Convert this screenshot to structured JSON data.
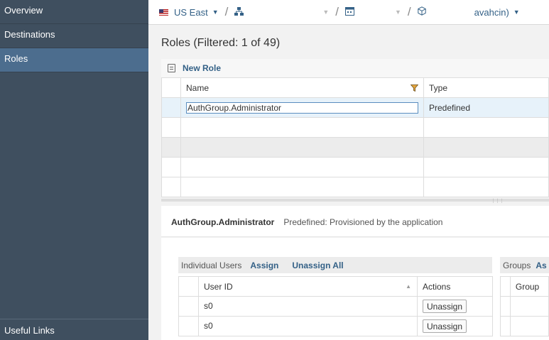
{
  "sidebar": {
    "items": [
      {
        "label": "Overview"
      },
      {
        "label": "Destinations"
      },
      {
        "label": "Roles",
        "active": true
      }
    ],
    "bottom_label": "Useful Links"
  },
  "topbar": {
    "region": "US East",
    "account_suffix": "avahcin)"
  },
  "title": "Roles (Filtered: 1 of 49)",
  "roles_table": {
    "new_role_label": "New Role",
    "columns": [
      "Name",
      "Type"
    ],
    "rows": [
      {
        "name": "AuthGroup.Administrator",
        "type": "Predefined"
      }
    ]
  },
  "detail": {
    "role_name": "AuthGroup.Administrator",
    "role_desc": "Predefined: Provisioned by the application"
  },
  "users": {
    "label": "Individual Users",
    "assign_label": "Assign",
    "unassign_all_label": "Unassign All",
    "columns": [
      "User ID",
      "Actions"
    ],
    "rows": [
      {
        "user_id": "s0",
        "action": "Unassign"
      },
      {
        "user_id": "s0",
        "action": "Unassign"
      }
    ]
  },
  "groups": {
    "label": "Groups",
    "assign_label": "As",
    "columns": [
      "Group"
    ]
  },
  "colors": {
    "sidebar_bg": "#3f4f5f",
    "sidebar_active": "#4c6d8e",
    "link_blue": "#346187"
  }
}
